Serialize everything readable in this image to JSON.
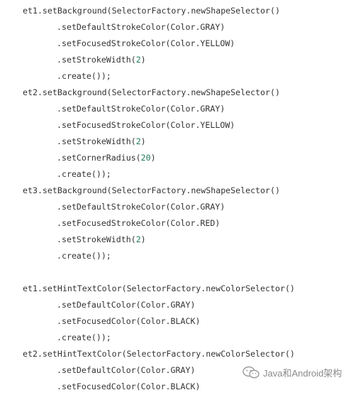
{
  "code": {
    "lines": [
      {
        "indent": 0,
        "text": "et1.setBackground(SelectorFactory.newShapeSelector()"
      },
      {
        "indent": 1,
        "text": ".setDefaultStrokeColor(Color.GRAY)"
      },
      {
        "indent": 1,
        "text": ".setFocusedStrokeColor(Color.YELLOW)"
      },
      {
        "indent": 1,
        "text": ".setStrokeWidth(2)"
      },
      {
        "indent": 1,
        "text": ".create());"
      },
      {
        "indent": 0,
        "text": "et2.setBackground(SelectorFactory.newShapeSelector()"
      },
      {
        "indent": 1,
        "text": ".setDefaultStrokeColor(Color.GRAY)"
      },
      {
        "indent": 1,
        "text": ".setFocusedStrokeColor(Color.YELLOW)"
      },
      {
        "indent": 1,
        "text": ".setStrokeWidth(2)"
      },
      {
        "indent": 1,
        "text": ".setCornerRadius(20)"
      },
      {
        "indent": 1,
        "text": ".create());"
      },
      {
        "indent": 0,
        "text": "et3.setBackground(SelectorFactory.newShapeSelector()"
      },
      {
        "indent": 1,
        "text": ".setDefaultStrokeColor(Color.GRAY)"
      },
      {
        "indent": 1,
        "text": ".setFocusedStrokeColor(Color.RED)"
      },
      {
        "indent": 1,
        "text": ".setStrokeWidth(2)"
      },
      {
        "indent": 1,
        "text": ".create());"
      },
      {
        "indent": 0,
        "text": ""
      },
      {
        "indent": 0,
        "text": "et1.setHintTextColor(SelectorFactory.newColorSelector()"
      },
      {
        "indent": 1,
        "text": ".setDefaultColor(Color.GRAY)"
      },
      {
        "indent": 1,
        "text": ".setFocusedColor(Color.BLACK)"
      },
      {
        "indent": 1,
        "text": ".create());"
      },
      {
        "indent": 0,
        "text": "et2.setHintTextColor(SelectorFactory.newColorSelector()"
      },
      {
        "indent": 1,
        "text": ".setDefaultColor(Color.GRAY)"
      },
      {
        "indent": 1,
        "text": ".setFocusedColor(Color.BLACK)"
      }
    ]
  },
  "watermark": {
    "text": "Java和Android架构",
    "icon": "wechat-icon"
  },
  "colors": {
    "code_text": "#333333",
    "number": "#1f7a5c",
    "watermark": "#8a8a8a",
    "background": "#ffffff"
  }
}
